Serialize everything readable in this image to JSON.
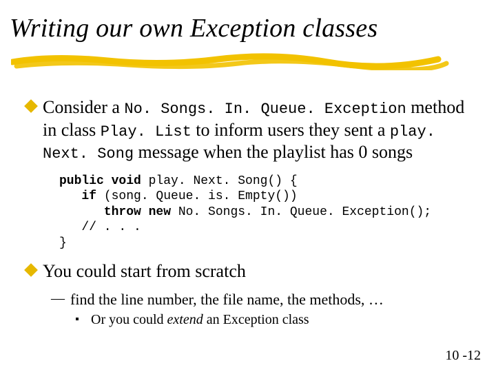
{
  "title": "Writing our own Exception classes",
  "bullets": {
    "b1a": {
      "pre": "Consider a ",
      "code1": "No. Songs. In. Queue. Exception",
      "mid": " method in class ",
      "code2": "Play. List",
      "mid2": " to inform users they sent a ",
      "code3": "play. Next. Song",
      "post": " message when the playlist has 0 songs"
    },
    "code": {
      "l1a": "public void",
      "l1b": " play. Next. Song() {",
      "l2a": "   if",
      "l2b": " (song. Queue. is. Empty())",
      "l3a": "      throw new",
      "l3b": " No. Songs. In. Queue. Exception();",
      "l4": "   // . . .",
      "l5": "}"
    },
    "b1b": "You could start from scratch",
    "b2": "find the line number, the file name, the methods, …",
    "b3": {
      "pre": "Or you could ",
      "em": "extend",
      "post": " an Exception class"
    }
  },
  "footer": "10 -12"
}
